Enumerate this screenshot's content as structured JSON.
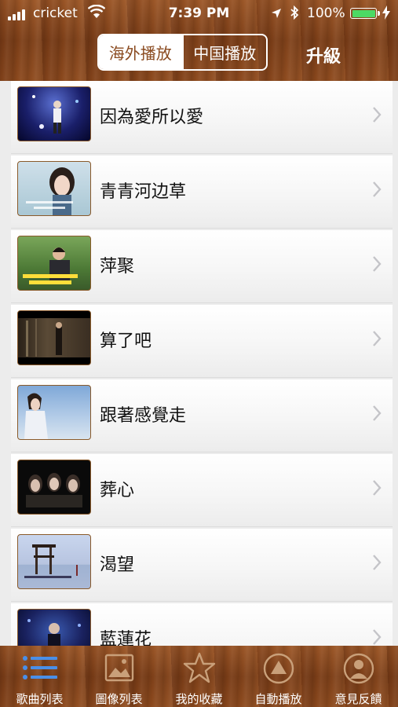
{
  "status_bar": {
    "carrier": "cricket",
    "time": "7:39 PM",
    "battery_text": "100%",
    "battery_level": 1.0,
    "battery_color": "#4cd964"
  },
  "header": {
    "segments": [
      {
        "label": "海外播放",
        "selected": true
      },
      {
        "label": "中国播放",
        "selected": false
      }
    ],
    "upgrade_label": "升級"
  },
  "songs": [
    {
      "title": "因為愛所以愛",
      "thumb": "stage-singer"
    },
    {
      "title": "青青河边草",
      "thumb": "girl-portrait"
    },
    {
      "title": "萍聚",
      "thumb": "man-outdoors"
    },
    {
      "title": "算了吧",
      "thumb": "dark-forest"
    },
    {
      "title": "跟著感覺走",
      "thumb": "girl-sky"
    },
    {
      "title": "葬心",
      "thumb": "three-women"
    },
    {
      "title": "渴望",
      "thumb": "lifeguard-tower"
    },
    {
      "title": "藍蓮花",
      "thumb": "stage-blue"
    }
  ],
  "tabs": [
    {
      "label": "歌曲列表",
      "icon": "list-icon",
      "active": true
    },
    {
      "label": "圖像列表",
      "icon": "image-icon",
      "active": false
    },
    {
      "label": "我的收藏",
      "icon": "star-icon",
      "active": false
    },
    {
      "label": "自動播放",
      "icon": "play-icon",
      "active": false
    },
    {
      "label": "意見反饋",
      "icon": "person-icon",
      "active": false
    }
  ],
  "colors": {
    "accent": "#8a4a1f",
    "active_tab": "#1a73e8"
  }
}
